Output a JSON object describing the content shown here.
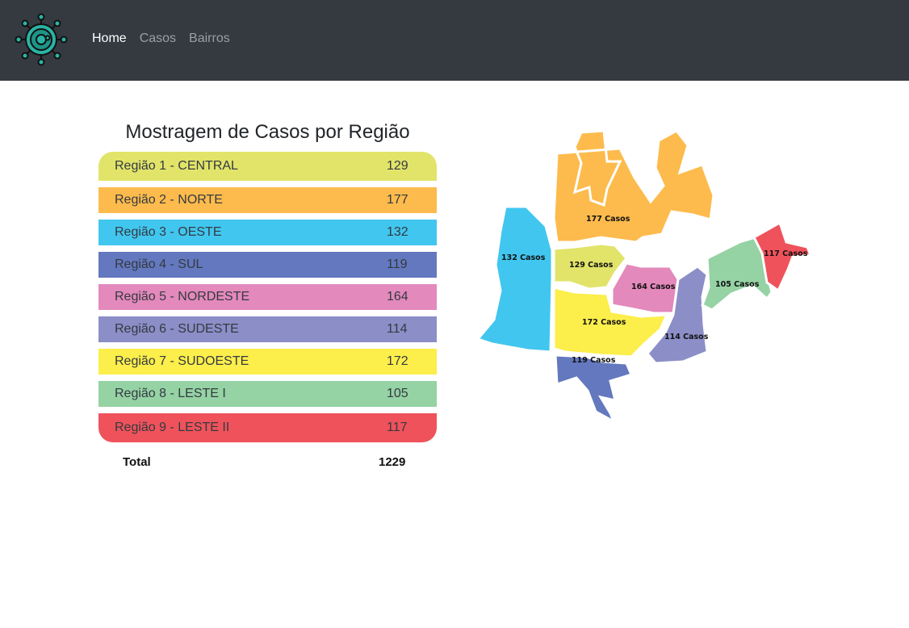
{
  "navbar": {
    "logo_icon": "virus-icon",
    "links": [
      {
        "label": "Home",
        "active": true
      },
      {
        "label": "Casos",
        "active": false
      },
      {
        "label": "Bairros",
        "active": false
      }
    ]
  },
  "main": {
    "title": "Mostragem de Casos por Região",
    "regions": [
      {
        "label": "Região 1 - CENTRAL",
        "value": "129",
        "color": "#e2e46a"
      },
      {
        "label": "Região 2 - NORTE",
        "value": "177",
        "color": "#fdbb4d"
      },
      {
        "label": "Região 3 - OESTE",
        "value": "132",
        "color": "#41c6ef"
      },
      {
        "label": "Região 4 - SUL",
        "value": "119",
        "color": "#6378be"
      },
      {
        "label": "Região 5 - NORDESTE",
        "value": "164",
        "color": "#e389bc"
      },
      {
        "label": "Região 6 - SUDESTE",
        "value": "114",
        "color": "#8b8ec7"
      },
      {
        "label": "Região 7 - SUDOESTE",
        "value": "172",
        "color": "#fcee4b"
      },
      {
        "label": "Região 8 - LESTE I",
        "value": "105",
        "color": "#95d2a4"
      },
      {
        "label": "Região 9 - LESTE II",
        "value": "117",
        "color": "#ef525b"
      }
    ],
    "total": {
      "label": "Total",
      "value": "1229"
    }
  },
  "map": {
    "labels": {
      "central": "129 Casos",
      "norte": "177 Casos",
      "oeste": "132 Casos",
      "sul": "119 Casos",
      "nordeste": "164 Casos",
      "sudeste": "114 Casos",
      "sudoeste": "172 Casos",
      "leste1": "105 Casos",
      "leste2": "117 Casos"
    }
  }
}
